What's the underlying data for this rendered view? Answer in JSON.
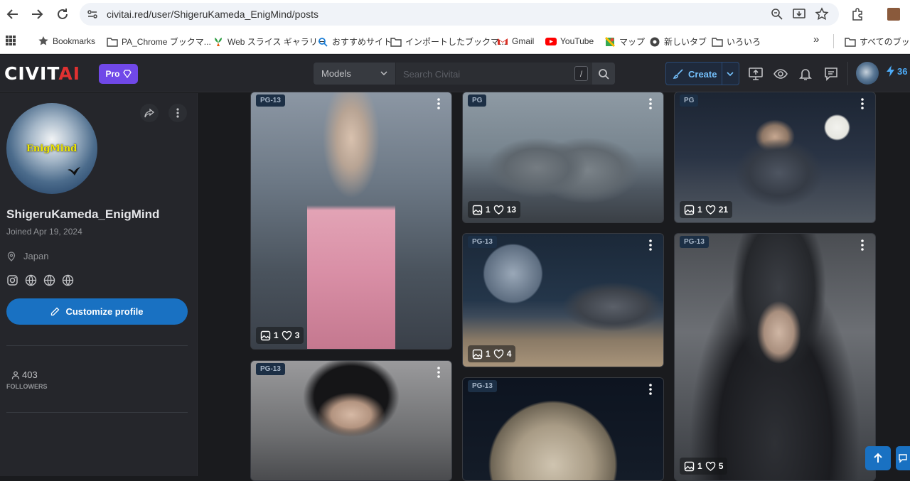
{
  "browser": {
    "url": "civitai.red/user/ShigeruKameda_EnigMind/posts",
    "bookmarks": [
      {
        "label": "Bookmarks",
        "icon": "star-icon"
      },
      {
        "label": "PA_Chrome ブックマ...",
        "icon": "folder-icon"
      },
      {
        "label": "Web スライス ギャラリー",
        "icon": "webslice-icon"
      },
      {
        "label": "おすすめサイト",
        "icon": "search-icon"
      },
      {
        "label": "インポートしたブックマ...",
        "icon": "folder-icon"
      },
      {
        "label": "Gmail",
        "icon": "gmail-icon"
      },
      {
        "label": "YouTube",
        "icon": "youtube-icon"
      },
      {
        "label": "マップ",
        "icon": "maps-icon"
      },
      {
        "label": "新しいタブ",
        "icon": "globe-icon"
      },
      {
        "label": "いろいろ",
        "icon": "folder-icon"
      }
    ],
    "overflow_label": "»",
    "all_bookmarks": "すべてのブックマーク"
  },
  "header": {
    "logo_left": "CIVIT",
    "logo_right": "AI",
    "pro_label": "Pro",
    "search_scope": "Models",
    "search_placeholder": "Search Civitai",
    "shortcut": "/",
    "create_label": "Create",
    "buzz_count": "36"
  },
  "profile": {
    "avatar_text": "EnigMind",
    "username": "ShigeruKameda_EnigMind",
    "joined": "Joined Apr 19, 2024",
    "location": "Japan",
    "customize_label": "Customize profile",
    "followers_count": "403",
    "followers_label": "FOLLOWERS"
  },
  "posts": [
    {
      "rating": "PG-13",
      "images": "1",
      "likes": "3"
    },
    {
      "rating": "PG-13",
      "images": "",
      "likes": ""
    },
    {
      "rating": "PG",
      "images": "1",
      "likes": "13"
    },
    {
      "rating": "PG-13",
      "images": "1",
      "likes": "4"
    },
    {
      "rating": "PG-13",
      "images": "",
      "likes": ""
    },
    {
      "rating": "PG",
      "images": "1",
      "likes": "21"
    },
    {
      "rating": "PG-13",
      "images": "1",
      "likes": "5"
    }
  ],
  "colors": {
    "accent": "#1971c2",
    "pro": "#7048e8",
    "logo_red": "#e03131",
    "bg": "#1a1b1e",
    "panel": "#25262b"
  }
}
